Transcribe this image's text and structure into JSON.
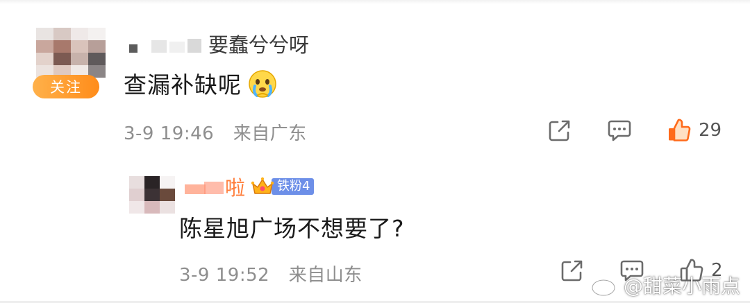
{
  "comments": [
    {
      "author": "要蠢兮兮呀",
      "badge_label": "关注",
      "text": "查漏补缺呢",
      "emoji": "crying-face-emoji",
      "time": "3-9 19:46",
      "location": "来自广东",
      "likes": "29"
    },
    {
      "author": "啦",
      "fan_badge": "铁粉4",
      "text": "陈星旭广场不想要了?",
      "time": "3-9 19:52",
      "location": "来自山东",
      "likes": "2"
    }
  ],
  "watermark": {
    "text": "@甜菜小雨点"
  },
  "colors": {
    "follow_badge": "#ff9a2e",
    "fan_badge": "#6d8fe8",
    "like_active": "#ff6a1a",
    "meta_text": "#8e8e8e",
    "icon_gray": "#6b6b6b"
  }
}
